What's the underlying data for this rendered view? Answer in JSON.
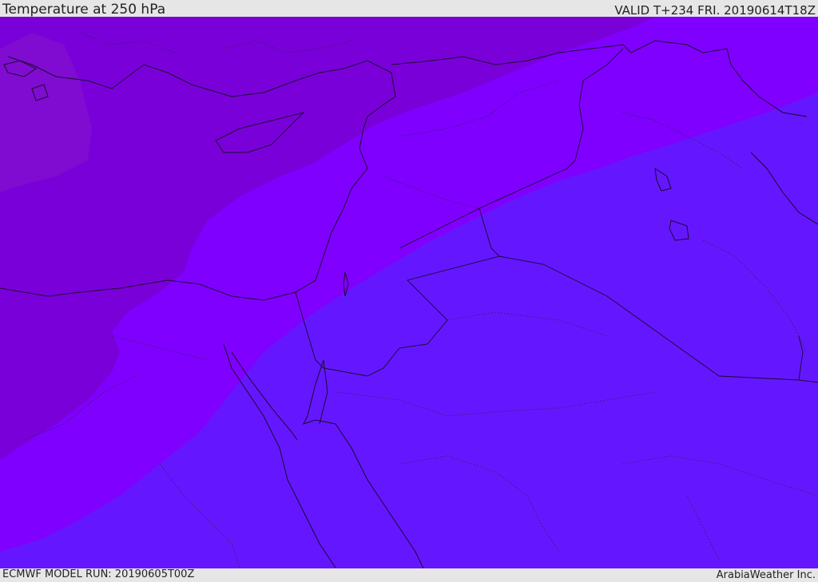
{
  "header": {
    "title": "Temperature at 250 hPa",
    "valid": "VALID T+234 FRI. 20190614T18Z"
  },
  "footer": {
    "model_run": "ECMWF MODEL RUN: 20190605T00Z",
    "credit": "ArabiaWeather Inc."
  },
  "colors": {
    "band_coldest": "#7a00d9",
    "band_mid": "#8000ff",
    "band_warm": "#6417ff",
    "coastline": "#1a0a2e",
    "background": "#e6e6e6"
  }
}
